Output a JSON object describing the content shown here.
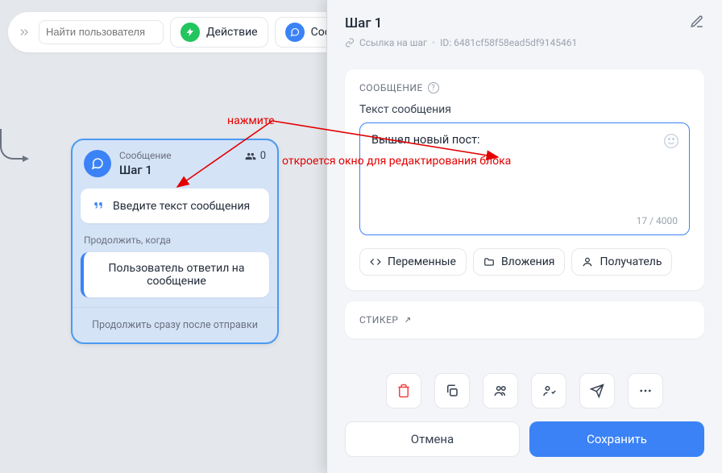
{
  "toolbar": {
    "search_placeholder": "Найти пользователя",
    "action_label": "Действие",
    "message_label": "Сооб"
  },
  "node": {
    "type_label": "Сообщение",
    "name": "Шаг 1",
    "users_count": "0",
    "msg_placeholder": "Введите текст сообщения",
    "continue_label": "Продолжить, когда",
    "continue_option": "Пользователь ответил на сообщение",
    "footer_label": "Продолжить сразу после отправки"
  },
  "panel": {
    "title": "Шаг 1",
    "link_label": "Ссылка на шаг",
    "id_label": "ID: 6481cf58f58ead5df9145461",
    "message_section": "СООБЩЕНИЕ",
    "text_field_label": "Текст сообщения",
    "text_value": "Вышел новый пост:",
    "char_count": "17 / 4000",
    "chip_vars": "Переменные",
    "chip_attach": "Вложения",
    "chip_recipient": "Получатель",
    "sticker_section": "СТИКЕР",
    "cancel_label": "Отмена",
    "save_label": "Сохранить"
  },
  "annotations": {
    "press": "нажмите",
    "opens": "откроется окно для редактирования блока"
  }
}
